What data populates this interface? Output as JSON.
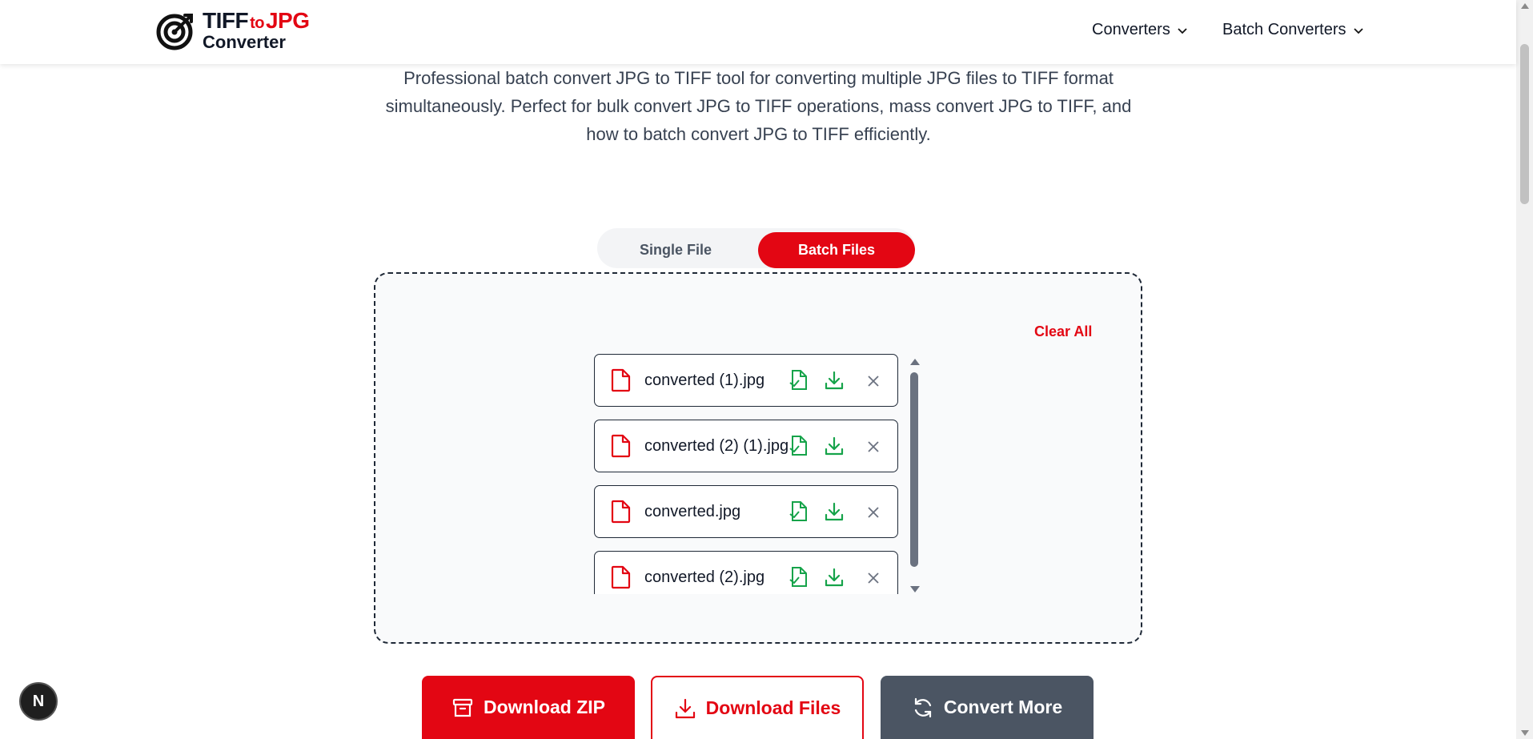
{
  "header": {
    "logo": {
      "line1_part1": "TIFF",
      "line1_to": "to",
      "line1_part2": "JPG",
      "line2": "Converter"
    },
    "nav": [
      {
        "label": "Converters"
      },
      {
        "label": "Batch Converters"
      }
    ]
  },
  "description": "Professional batch convert JPG to TIFF tool for converting multiple JPG files to TIFF format simultaneously. Perfect for bulk convert JPG to TIFF operations, mass convert JPG to TIFF, and how to batch convert JPG to TIFF efficiently.",
  "mode_toggle": {
    "options": [
      {
        "label": "Single File",
        "selected": false
      },
      {
        "label": "Batch Files",
        "selected": true
      }
    ]
  },
  "batch": {
    "clear_all_label": "Clear All",
    "files": [
      {
        "name": "converted (1).jpg"
      },
      {
        "name": "converted (2) (1).jpg"
      },
      {
        "name": "converted.jpg"
      },
      {
        "name": "converted (2).jpg"
      }
    ]
  },
  "actions": {
    "download_zip": "Download ZIP",
    "download_files": "Download Files",
    "convert_more": "Convert More"
  },
  "badge": {
    "label": "N"
  },
  "colors": {
    "accent": "#e30613",
    "action_green": "#16a34a",
    "secondary": "#4b5563"
  },
  "icons": {
    "file": "file-icon",
    "convert": "file-check-icon",
    "download": "download-icon",
    "remove": "close-icon",
    "zip": "archive-icon",
    "refresh": "refresh-icon"
  }
}
